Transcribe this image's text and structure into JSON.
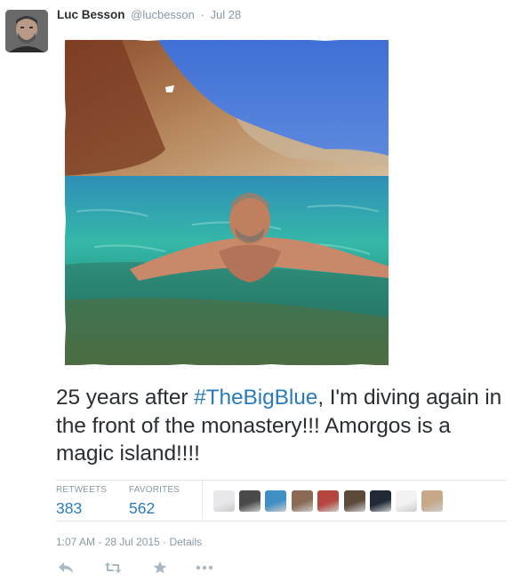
{
  "tweet": {
    "author_name": "Luc Besson",
    "author_handle": "@lucbesson",
    "separator": "·",
    "date": "Jul 28",
    "text_before_hashtag": "25 years after ",
    "hashtag": "#TheBigBlue",
    "text_after_hashtag": ", I'm diving again in the front of the monastery!!! Amorgos is a magic island!!!!"
  },
  "stats": {
    "retweets_label": "RETWEETS",
    "retweets_count": "383",
    "favorites_label": "FAVORITES",
    "favorites_count": "562"
  },
  "favoriters": [
    {
      "name": "favoriter-avatar-1",
      "color": "#e8e8ec"
    },
    {
      "name": "favoriter-avatar-2",
      "color": "#4a4a4a"
    },
    {
      "name": "favoriter-avatar-3",
      "color": "#3f8fc4"
    },
    {
      "name": "favoriter-avatar-4",
      "color": "#8a6a55"
    },
    {
      "name": "favoriter-avatar-5",
      "color": "#b5453f"
    },
    {
      "name": "favoriter-avatar-6",
      "color": "#5b4a3a"
    },
    {
      "name": "favoriter-avatar-7",
      "color": "#1f2a36"
    },
    {
      "name": "favoriter-avatar-8",
      "color": "#f2f2f2"
    },
    {
      "name": "favoriter-avatar-9",
      "color": "#c7a98a"
    }
  ],
  "meta": {
    "timestamp": "1:07 AM - 28 Jul 2015",
    "separator": "·",
    "details_label": "Details"
  },
  "actions": {
    "reply_icon": "reply-icon",
    "retweet_icon": "retweet-icon",
    "favorite_icon": "star-icon",
    "more_icon": "more-icon"
  },
  "colors": {
    "link": "#2b7bb9",
    "muted": "#8899a6",
    "text": "#292f33",
    "divider": "#e1e8ed"
  }
}
